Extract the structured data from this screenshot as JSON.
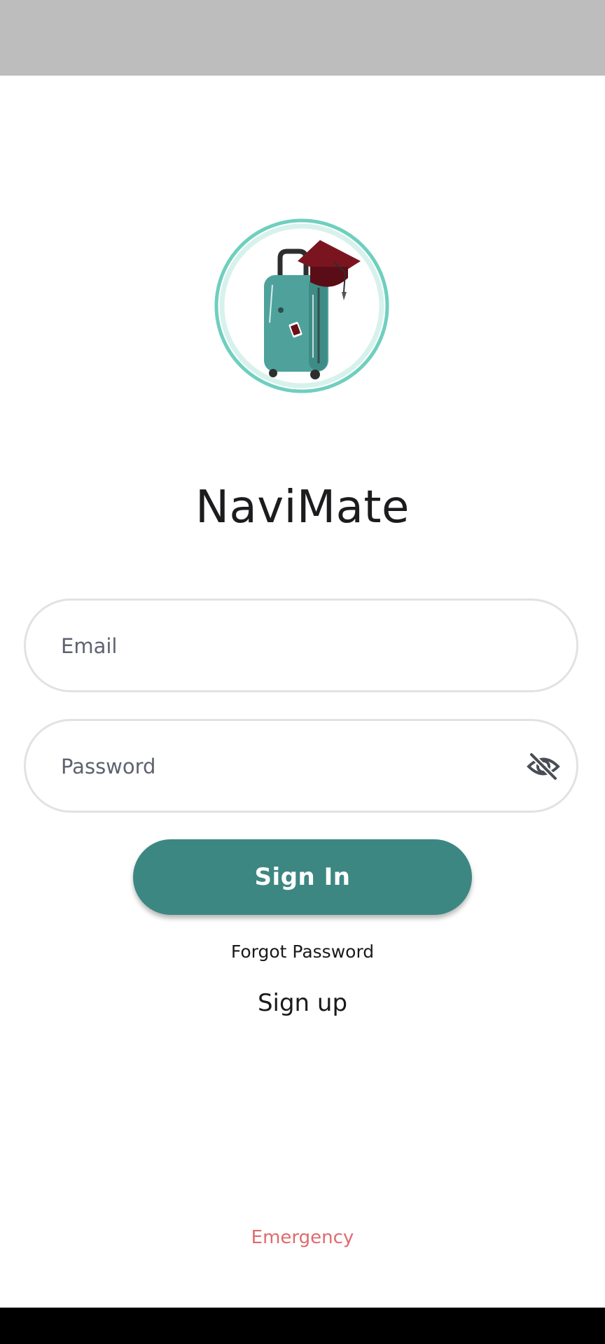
{
  "app": {
    "title": "NaviMate",
    "logo_icon": "suitcase-graduation-cap-logo",
    "accent_color": "#3d8782"
  },
  "login": {
    "email_placeholder": "Email",
    "email_value": "",
    "password_placeholder": "Password",
    "password_value": "",
    "password_toggle_icon": "eye-off-icon",
    "signin_label": "Sign In",
    "forgot_label": "Forgot Password",
    "signup_label": "Sign up"
  },
  "footer": {
    "emergency_label": "Emergency",
    "emergency_color": "#e06a6e"
  }
}
